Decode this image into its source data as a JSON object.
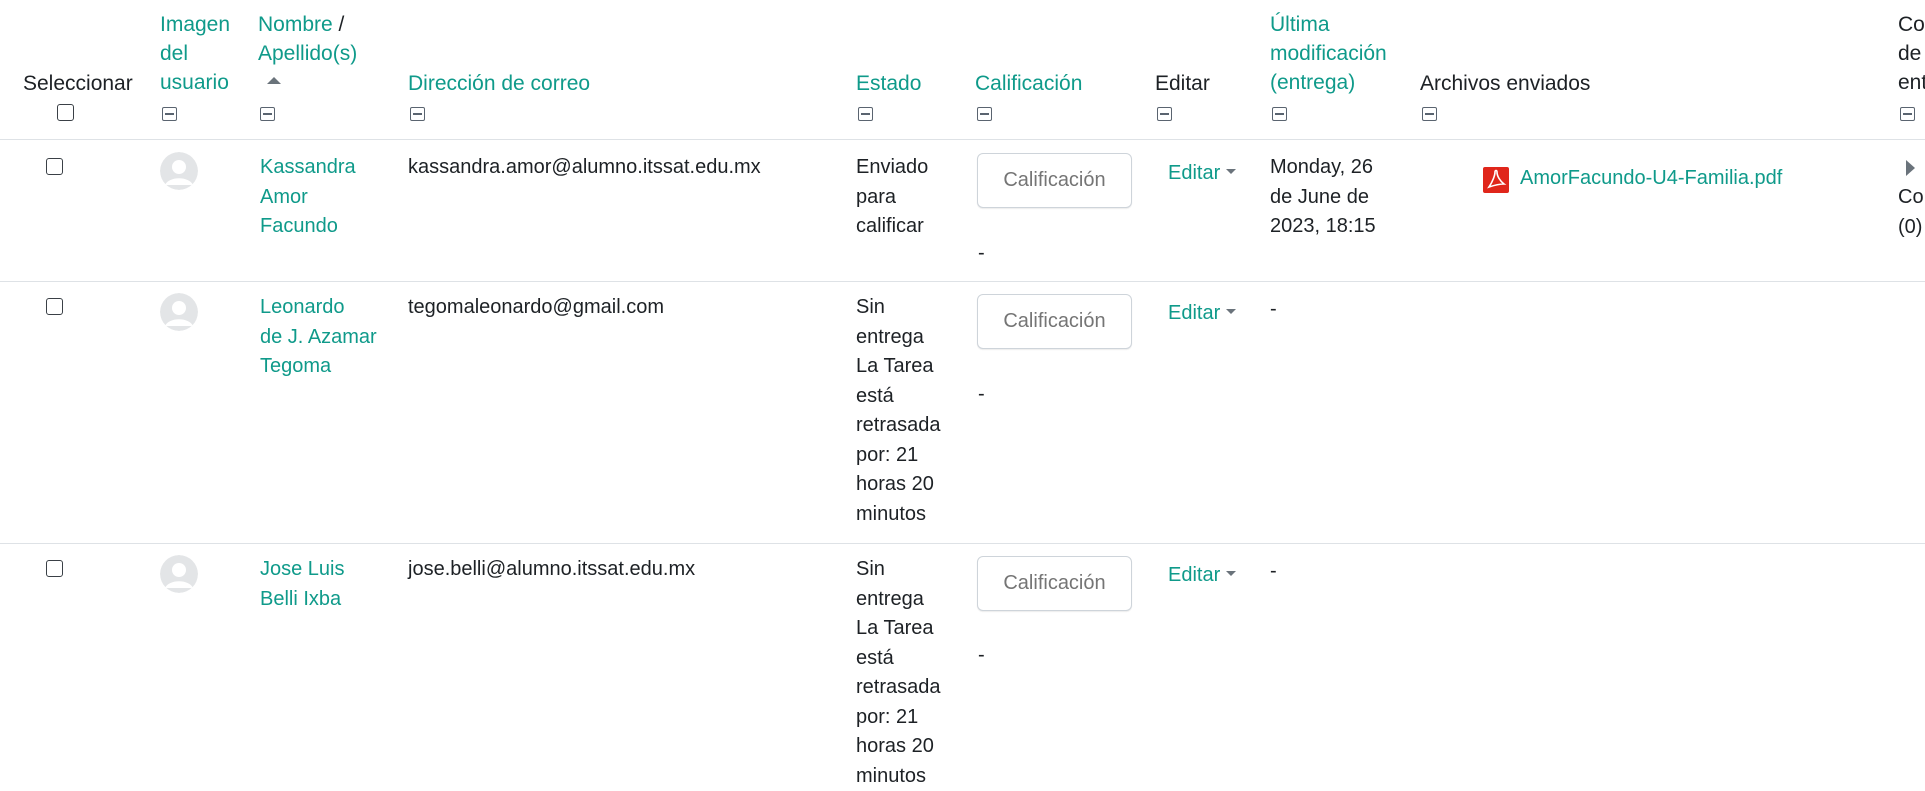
{
  "headers": {
    "select": "Seleccionar",
    "user_image": [
      "Imagen",
      "del",
      "usuario"
    ],
    "name_link": "Nombre",
    "name_sep": " / ",
    "surname": "Apellido(s)",
    "email": "Dirección de correo",
    "status": "Estado",
    "grade": "Calificación",
    "edit": "Editar",
    "last_modified": [
      "Última",
      "modificación",
      "(entrega)"
    ],
    "files": "Archivos enviados",
    "comments_partial": [
      "Cor",
      "de",
      "ent"
    ]
  },
  "rows": [
    {
      "name": [
        "Kassandra",
        "Amor",
        "Facundo"
      ],
      "email": "kassandra.amor@alumno.itssat.edu.mx",
      "status": [
        "Enviado",
        "para",
        "calificar"
      ],
      "grade_placeholder": "Calificación",
      "grade_value": "-",
      "edit": "Editar",
      "last_modified": [
        "Monday, 26",
        "de June de",
        "2023, 18:15"
      ],
      "file": "AmorFacundo-U4-Familia.pdf",
      "comments": [
        "Co",
        "(0)"
      ]
    },
    {
      "name": [
        "Leonardo",
        "de J. Azamar",
        "Tegoma"
      ],
      "email": "tegomaleonardo@gmail.com",
      "status": [
        "Sin",
        "entrega",
        "La Tarea",
        "está",
        "retrasada",
        "por: 21",
        "horas 20",
        "minutos"
      ],
      "grade_placeholder": "Calificación",
      "grade_value": "-",
      "edit": "Editar",
      "last_modified": [
        "-"
      ]
    },
    {
      "name": [
        "Jose Luis",
        "Belli Ixba"
      ],
      "email": "jose.belli@alumno.itssat.edu.mx",
      "status": [
        "Sin",
        "entrega",
        "La Tarea",
        "está",
        "retrasada",
        "por: 21",
        "horas 20",
        "minutos"
      ],
      "grade_placeholder": "Calificación",
      "grade_value": "-",
      "edit": "Editar",
      "last_modified": [
        "-"
      ]
    }
  ],
  "colors": {
    "link": "#0f9a8a",
    "text": "#1d2125",
    "border": "#dee2e6",
    "placeholder": "#9aa0a6",
    "pdf_red": "#e0261b"
  },
  "icons": [
    "collapse-icon",
    "sort-ascending-icon",
    "avatar-placeholder-icon",
    "dropdown-caret-icon",
    "pdf-file-icon",
    "expand-arrow-icon"
  ]
}
